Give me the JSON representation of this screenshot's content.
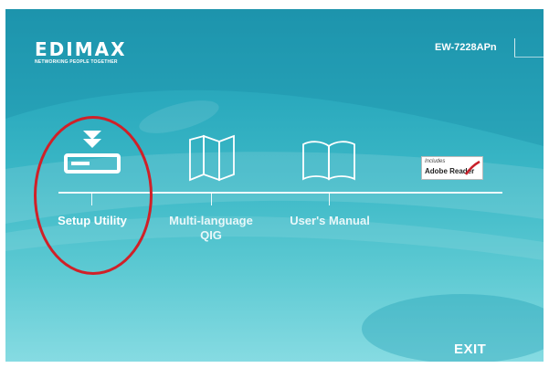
{
  "header": {
    "brand": "EDIMAX",
    "tagline": "NETWORKING PEOPLE TOGETHER",
    "model": "EW-7228APn"
  },
  "menu": {
    "items": [
      {
        "label_line1": "Setup Utility",
        "label_line2": "",
        "icon": "download-drive-icon",
        "active": true
      },
      {
        "label_line1": "Multi-language",
        "label_line2": "QIG",
        "icon": "folded-map-icon",
        "active": false
      },
      {
        "label_line1": "User's Manual",
        "label_line2": "",
        "icon": "open-book-icon",
        "active": false
      }
    ],
    "adobe": {
      "includes": "Includes",
      "product": "Adobe Reader"
    }
  },
  "footer": {
    "exit_label": "EXIT"
  },
  "colors": {
    "highlight": "#d02028",
    "background_top": "#1f98b0",
    "background_bottom": "#86dbe2"
  }
}
